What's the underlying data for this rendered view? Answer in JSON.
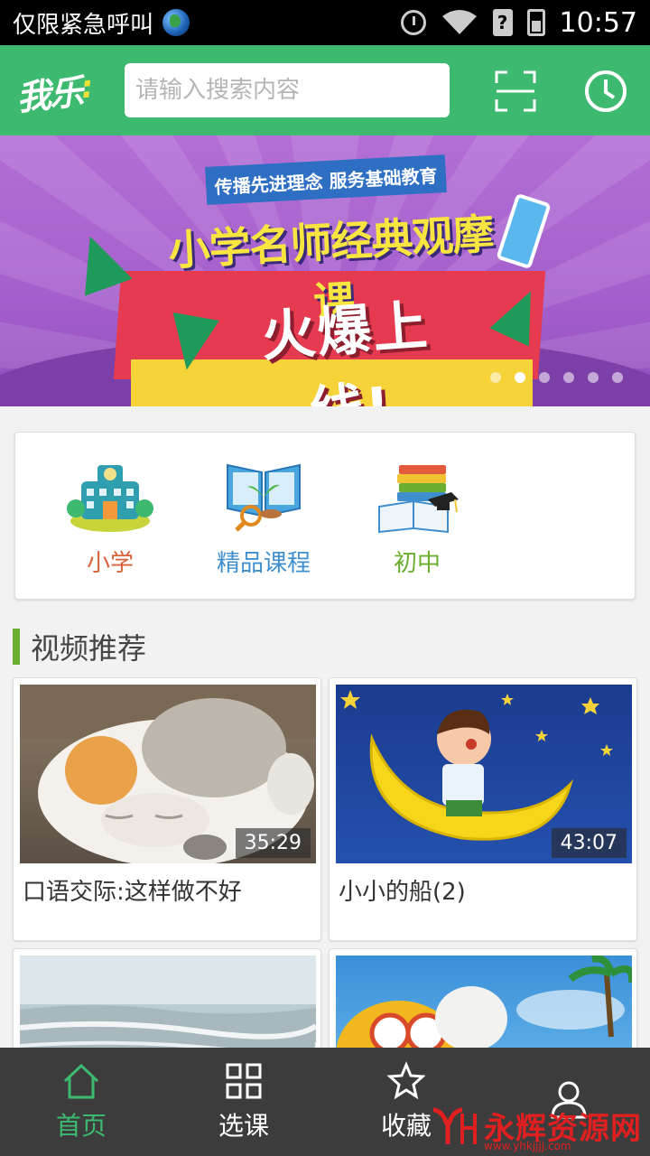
{
  "status_bar": {
    "carrier_text": "仅限紧急呼叫",
    "time": "10:57",
    "icons": [
      "globe-icon",
      "alarm-icon",
      "wifi-icon",
      "sim-icon",
      "battery-icon"
    ]
  },
  "header": {
    "logo_text": "我乐",
    "search_placeholder": "请输入搜索内容",
    "accent_color": "#3dba6f",
    "icons": [
      "scan-icon",
      "history-icon"
    ]
  },
  "banner": {
    "ribbon_text": "传播先进理念  服务基础教育",
    "title": "小学名师经典观摩课",
    "subtitle": "火爆上线!",
    "slide_count": 6,
    "active_slide": 2
  },
  "categories": [
    {
      "label": "小学",
      "icon": "school-building-icon",
      "color": "#d8623a"
    },
    {
      "label": "精品课程",
      "icon": "open-book-plant-icon",
      "color": "#3f8fcf"
    },
    {
      "label": "初中",
      "icon": "books-graduation-cap-icon",
      "color": "#6aae2f"
    }
  ],
  "section": {
    "title": "视频推荐"
  },
  "videos": [
    {
      "title": "口语交际:这样做不好",
      "duration": "35:29"
    },
    {
      "title": "小小的船(2)",
      "duration": "43:07"
    },
    {
      "title": "",
      "duration": ""
    },
    {
      "title": "",
      "duration": ""
    }
  ],
  "tab_bar": {
    "tabs": [
      {
        "label": "首页",
        "icon": "home-icon",
        "active": true
      },
      {
        "label": "选课",
        "icon": "grid-icon",
        "active": false
      },
      {
        "label": "收藏",
        "icon": "star-icon",
        "active": false
      },
      {
        "label": "",
        "icon": "user-icon",
        "active": false
      }
    ]
  },
  "watermark": {
    "text": "永辉资源网",
    "url": "www.yhkjjjj.com"
  }
}
